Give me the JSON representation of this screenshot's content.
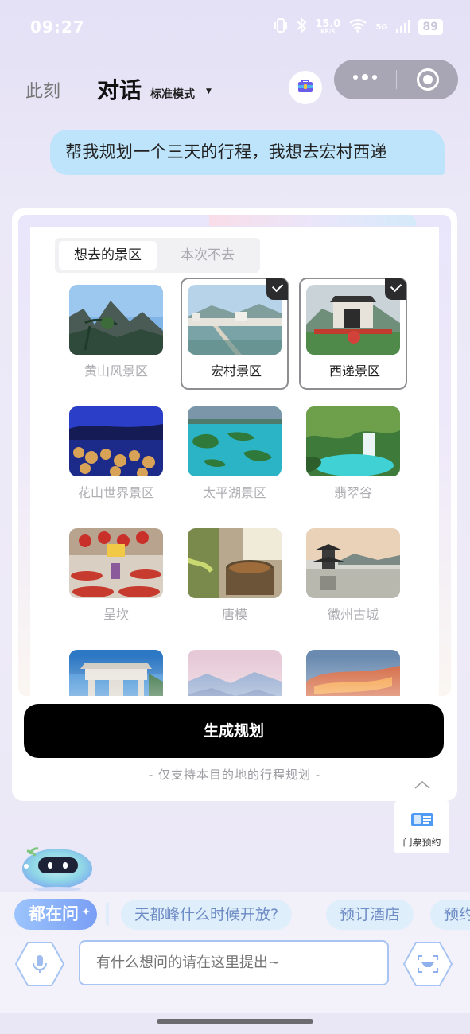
{
  "status_bar": {
    "time": "09:27",
    "net_speed": "15.0",
    "net_unit": "KB/S",
    "network": "5G",
    "battery": "89",
    "icons": [
      "vibrate-icon",
      "bluetooth-icon",
      "wifi-icon",
      "signal-icon"
    ]
  },
  "header": {
    "tab_now": "此刻",
    "tab_chat": "对话",
    "mode": "标准模式",
    "icons": [
      "shopping-bag-icon",
      "more-dots-icon",
      "target-icon"
    ]
  },
  "user_message": "帮我规划一个三天的行程，我想去宏村西递",
  "planner": {
    "tabs": [
      {
        "label": "想去的景区",
        "active": true
      },
      {
        "label": "本次不去",
        "active": false
      }
    ],
    "spots": [
      {
        "name": "黄山风景区",
        "selected": false,
        "scene": "mountain-pine"
      },
      {
        "name": "宏村景区",
        "selected": true,
        "scene": "village-lake"
      },
      {
        "name": "西递景区",
        "selected": true,
        "scene": "arch-gate"
      },
      {
        "name": "花山世界景区",
        "selected": false,
        "scene": "cave-lights"
      },
      {
        "name": "太平湖景区",
        "selected": false,
        "scene": "lake-islands"
      },
      {
        "name": "翡翠谷",
        "selected": false,
        "scene": "waterfall"
      },
      {
        "name": "呈坎",
        "selected": false,
        "scene": "red-peppers"
      },
      {
        "name": "唐模",
        "selected": false,
        "scene": "garden-pool"
      },
      {
        "name": "徽州古城",
        "selected": false,
        "scene": "pavilion-lake"
      },
      {
        "name": "",
        "selected": false,
        "scene": "memorial-arch"
      },
      {
        "name": "",
        "selected": false,
        "scene": "misty-mountains"
      },
      {
        "name": "",
        "selected": false,
        "scene": "sunset-clouds"
      }
    ],
    "generate_button": "生成规划",
    "note": "- 仅支持本目的地的行程规划 -"
  },
  "side_widget": {
    "label": "门票预约",
    "icon": "ticket-book-icon"
  },
  "chips": {
    "hot_label": "都在问",
    "items": [
      "天都峰什么时候开放?",
      "预订酒店",
      "预约"
    ]
  },
  "input": {
    "placeholder": "有什么想问的请在这里提出~"
  },
  "colors": {
    "accent": "#7a9ef5",
    "bubble": "#bde4fa",
    "chip_bg": "#dfeefb",
    "chip_text": "#6d8bc4"
  }
}
